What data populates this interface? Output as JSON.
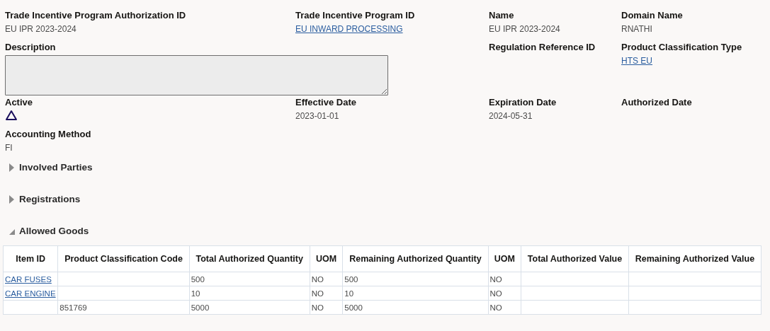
{
  "fields": [
    {
      "kind": "text",
      "label": "Trade Incentive Program Authorization ID",
      "value": "EU IPR 2023-2024"
    },
    {
      "kind": "link",
      "label": "Trade Incentive Program ID",
      "value": "EU INWARD PROCESSING"
    },
    {
      "kind": "text",
      "label": "Name",
      "value": "EU IPR 2023-2024"
    },
    {
      "kind": "text",
      "label": "Domain Name",
      "value": "RNATHI"
    },
    {
      "kind": "textarea",
      "label": "Description"
    },
    {
      "kind": "text",
      "label": "Regulation Reference ID"
    },
    {
      "kind": "link",
      "label": "Product Classification Type",
      "value": "HTS EU"
    },
    {
      "kind": "icon",
      "label": "Active"
    },
    {
      "kind": "text",
      "label": "Effective Date",
      "value": "2023-01-01"
    },
    {
      "kind": "text",
      "label": "Expiration Date",
      "value": "2024-05-31"
    },
    {
      "kind": "text",
      "label": "Authorized Date"
    },
    {
      "kind": "text",
      "label": "Accounting Method",
      "value": "FI"
    }
  ],
  "sections": [
    {
      "title": "Involved Parties",
      "expanded": false
    },
    {
      "title": "Registrations",
      "expanded": false
    },
    {
      "title": "Allowed Goods",
      "expanded": true
    }
  ],
  "table": {
    "columns": [
      "Item ID",
      "Product Classification Code",
      "Total Authorized Quantity",
      "UOM",
      "Remaining Authorized Quantity",
      "UOM",
      "Total Authorized Value",
      "Remaining Authorized Value"
    ],
    "rows": [
      {
        "cells": [
          "CAR FUSES",
          null,
          "500",
          "NO",
          "500",
          "NO",
          null,
          null
        ]
      },
      {
        "cells": [
          "CAR ENGINE",
          null,
          "10",
          "NO",
          "10",
          "NO",
          null,
          null
        ]
      },
      {
        "cells": [
          null,
          "851769",
          "5000",
          "NO",
          "5000",
          "NO",
          null,
          null
        ]
      }
    ]
  }
}
